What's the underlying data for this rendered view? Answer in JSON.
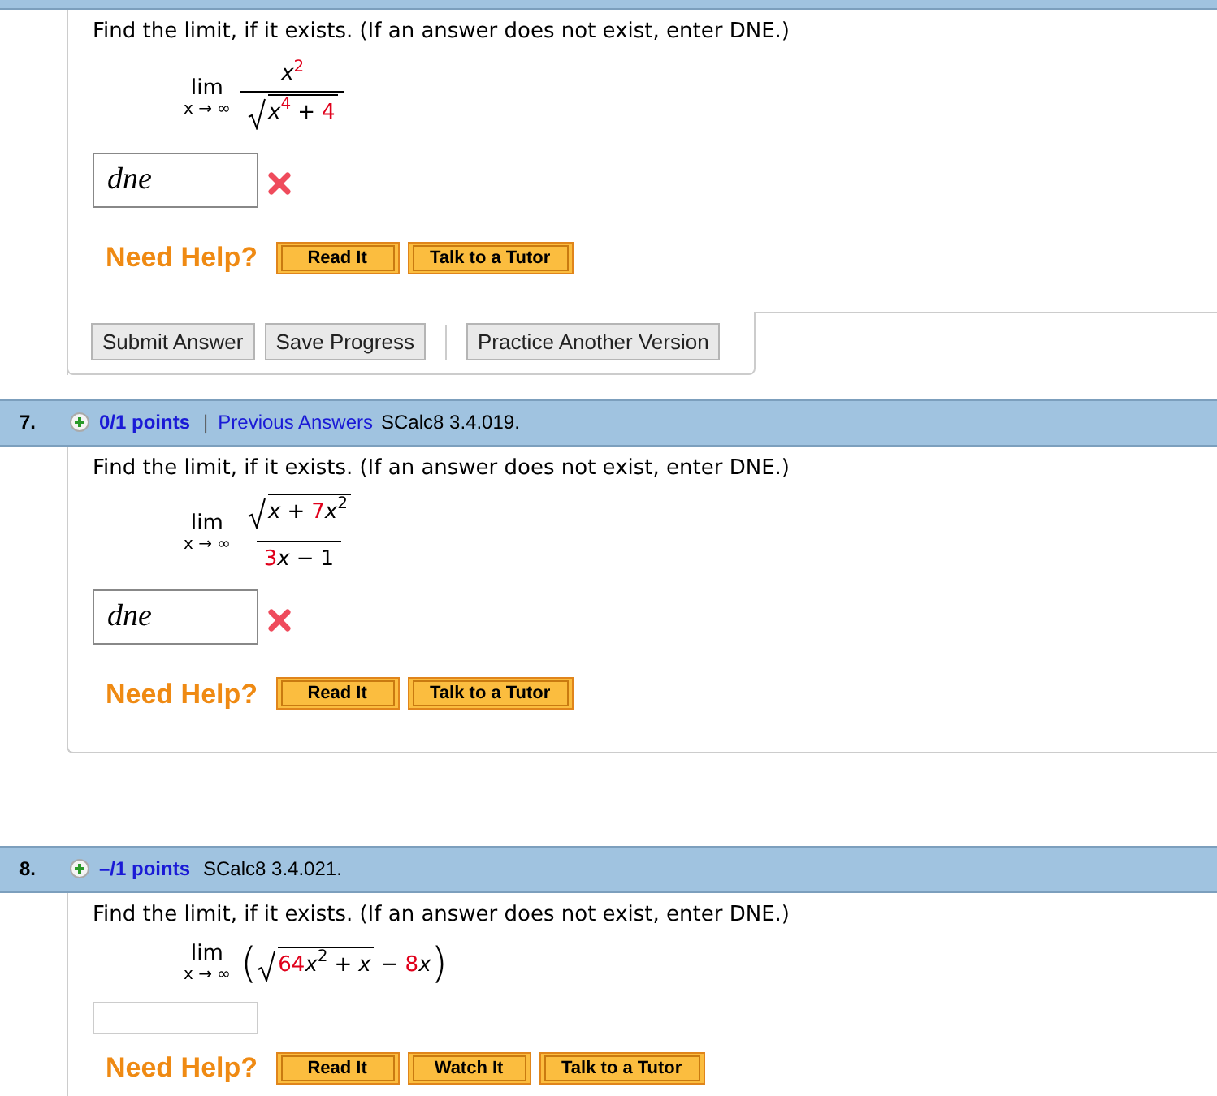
{
  "problems": [
    {
      "prompt": "Find the limit, if it exists. (If an answer does not exist, enter DNE.)",
      "math": {
        "kind": "fraction",
        "lim": "lim",
        "under": "x → ∞",
        "numerator": [
          {
            "kind": "var",
            "text": "x"
          },
          {
            "kind": "supcoef",
            "text": "2"
          }
        ],
        "denominator": [
          {
            "kind": "sqrt",
            "children": [
              {
                "kind": "var",
                "text": "x"
              },
              {
                "kind": "supcoef",
                "text": "4"
              },
              {
                "kind": "op",
                "text": "+"
              },
              {
                "kind": "coef",
                "text": "4"
              }
            ]
          }
        ]
      },
      "answer": {
        "value": "dne",
        "correct": false
      },
      "help_label": "Need Help?",
      "help_buttons": [
        "Read It",
        "Talk to a Tutor"
      ],
      "actions": [
        "Submit Answer",
        "Save Progress"
      ],
      "extra_action": "Practice Another Version"
    },
    {
      "header": {
        "number": "7.",
        "points": "0/1 points",
        "separator": "|",
        "previous_answers": "Previous Answers",
        "ref": "SCalc8 3.4.019."
      },
      "prompt": "Find the limit, if it exists. (If an answer does not exist, enter DNE.)",
      "math": {
        "kind": "fraction",
        "lim": "lim",
        "under": "x → ∞",
        "numerator": [
          {
            "kind": "sqrt",
            "children": [
              {
                "kind": "var",
                "text": "x"
              },
              {
                "kind": "op",
                "text": "+"
              },
              {
                "kind": "coef",
                "text": "7"
              },
              {
                "kind": "var",
                "text": "x"
              },
              {
                "kind": "sup",
                "text": "2"
              }
            ]
          }
        ],
        "denominator": [
          {
            "kind": "coef",
            "text": "3"
          },
          {
            "kind": "var",
            "text": "x"
          },
          {
            "kind": "op",
            "text": "−"
          },
          {
            "kind": "num",
            "text": "1"
          }
        ]
      },
      "answer": {
        "value": "dne",
        "correct": false
      },
      "help_label": "Need Help?",
      "help_buttons": [
        "Read It",
        "Talk to a Tutor"
      ]
    },
    {
      "header": {
        "number": "8.",
        "points": "–/1 points",
        "ref": "SCalc8 3.4.021."
      },
      "prompt": "Find the limit, if it exists. (If an answer does not exist, enter DNE.)",
      "math": {
        "kind": "paren",
        "lim": "lim",
        "under": "x → ∞",
        "open": "(",
        "close": ")",
        "body": [
          {
            "kind": "sqrt",
            "children": [
              {
                "kind": "coef",
                "text": "64"
              },
              {
                "kind": "var",
                "text": "x"
              },
              {
                "kind": "sup",
                "text": "2"
              },
              {
                "kind": "op",
                "text": "+"
              },
              {
                "kind": "var",
                "text": "x"
              }
            ]
          },
          {
            "kind": "op",
            "text": "−"
          },
          {
            "kind": "coef",
            "text": "8"
          },
          {
            "kind": "var",
            "text": "x"
          }
        ]
      },
      "help_label": "Need Help?",
      "help_buttons": [
        "Read It",
        "Watch It",
        "Talk to a Tutor"
      ]
    }
  ]
}
